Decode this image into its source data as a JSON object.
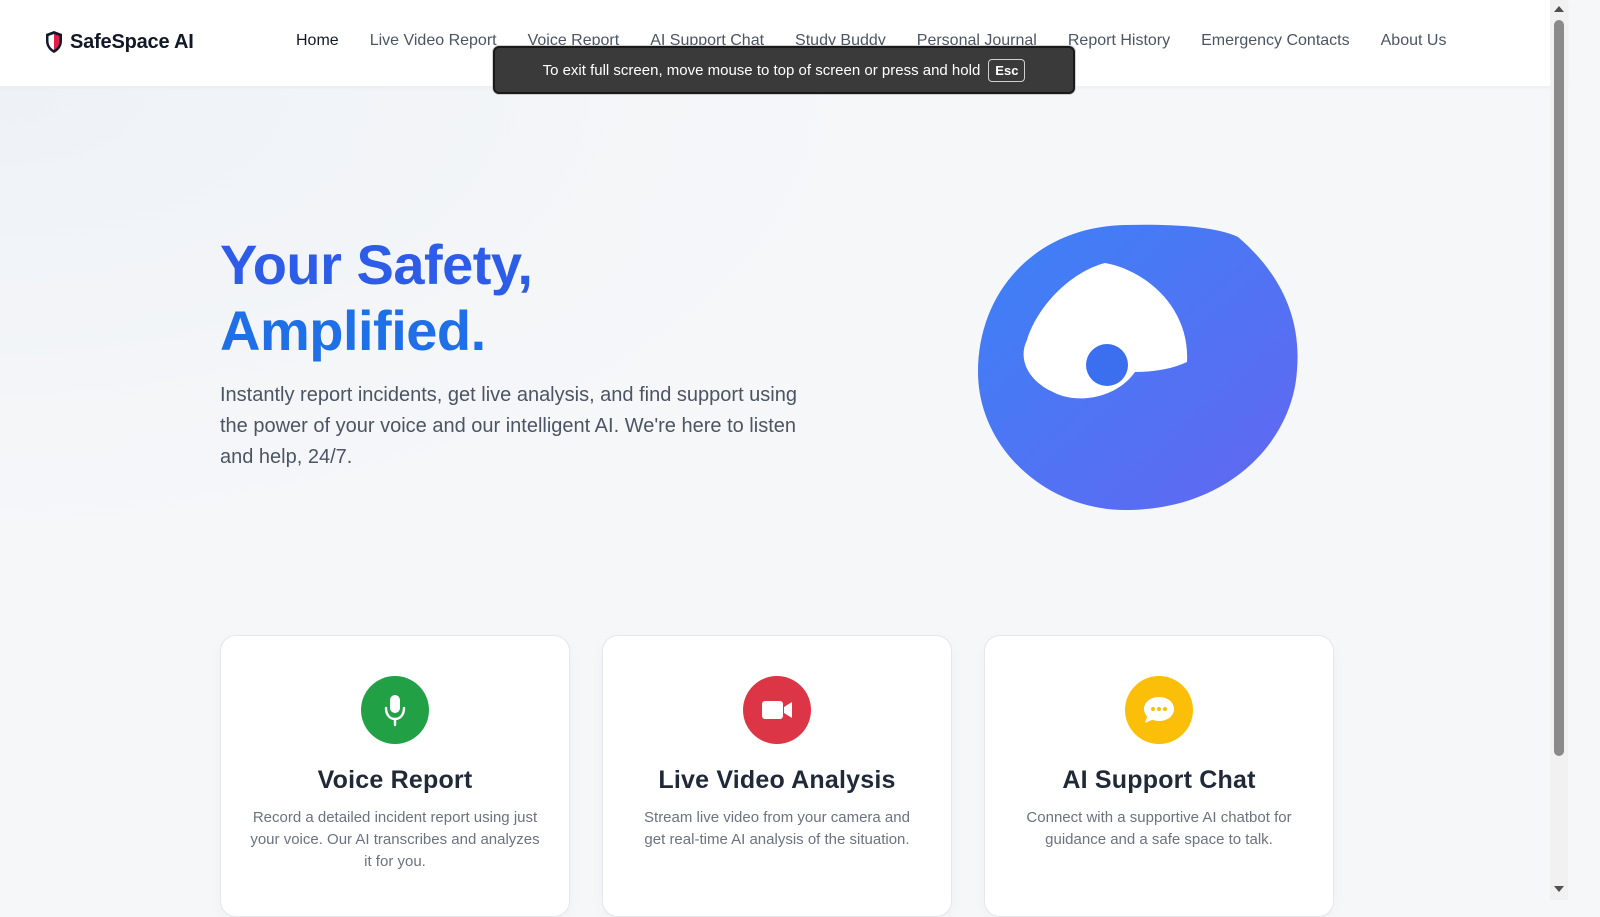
{
  "brand": {
    "name": "SafeSpace AI",
    "icon": "shield-icon",
    "icon_color": "#e11d48"
  },
  "nav": {
    "items": [
      {
        "label": "Home",
        "active": true
      },
      {
        "label": "Live Video Report"
      },
      {
        "label": "Voice Report"
      },
      {
        "label": "AI Support Chat"
      },
      {
        "label": "Study Buddy"
      },
      {
        "label": "Personal Journal"
      },
      {
        "label": "Report History"
      },
      {
        "label": "Emergency Contacts"
      },
      {
        "label": "About Us"
      }
    ]
  },
  "fullscreen_notice": {
    "text": "To exit full screen, move mouse to top of screen or press and hold",
    "key": "Esc"
  },
  "hero": {
    "title_line1": "Your Safety,",
    "title_line2": "Amplified.",
    "subtitle": "Instantly report incidents, get live analysis, and find support using the power of your voice and our intelligent AI. We're here to listen and help, 24/7.",
    "art_colors": {
      "start": "#3b82f6",
      "end": "#6366f1"
    }
  },
  "features": [
    {
      "title": "Voice Report",
      "description": "Record a detailed incident report using just your voice. Our AI transcribes and analyzes it for you.",
      "icon": "microphone-icon",
      "color": "#22a046"
    },
    {
      "title": "Live Video Analysis",
      "description": "Stream live video from your camera and get real-time AI analysis of the situation.",
      "icon": "video-camera-icon",
      "color": "#dc3545"
    },
    {
      "title": "AI Support Chat",
      "description": "Connect with a supportive AI chatbot for guidance and a safe space to talk.",
      "icon": "chat-bubble-icon",
      "color": "#fbbf09"
    }
  ]
}
